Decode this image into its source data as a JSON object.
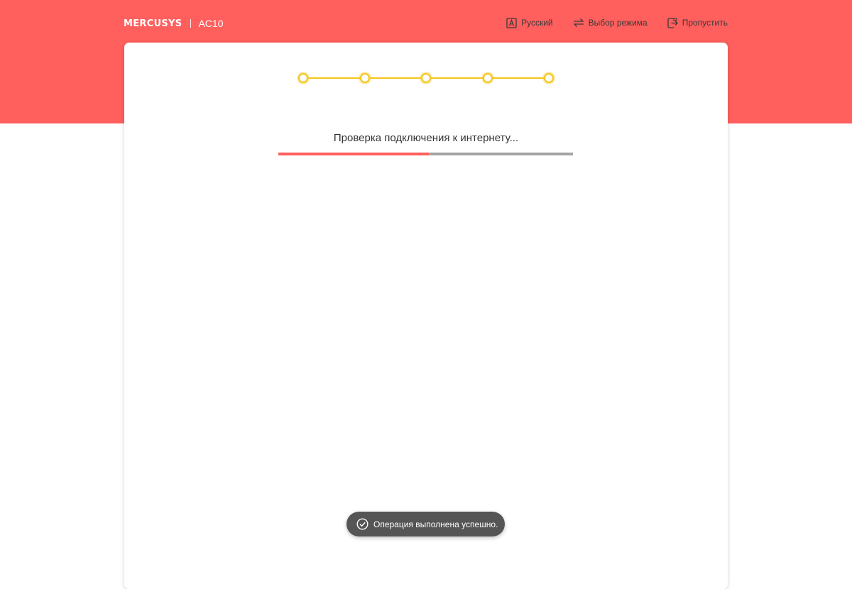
{
  "header": {
    "logo_text": "MERCUSYS",
    "model": "AC10",
    "background": "#ff5f5d",
    "nav": [
      {
        "label": "Русский",
        "icon": "language-icon"
      },
      {
        "label": "Выбор режима",
        "icon": "mode-switch-icon"
      },
      {
        "label": "Пропустить",
        "icon": "skip-exit-icon"
      }
    ]
  },
  "wizard": {
    "steps_total": 5,
    "step_color": "#f5c518",
    "status_text": "Проверка подключения к интернету...",
    "progress_fraction": 0.51,
    "progress_color": "#ff5f5d",
    "progress_track_color": "#a4a4a4"
  },
  "toast": {
    "icon": "check-circle-icon",
    "message": "Операция выполнена успешно."
  }
}
